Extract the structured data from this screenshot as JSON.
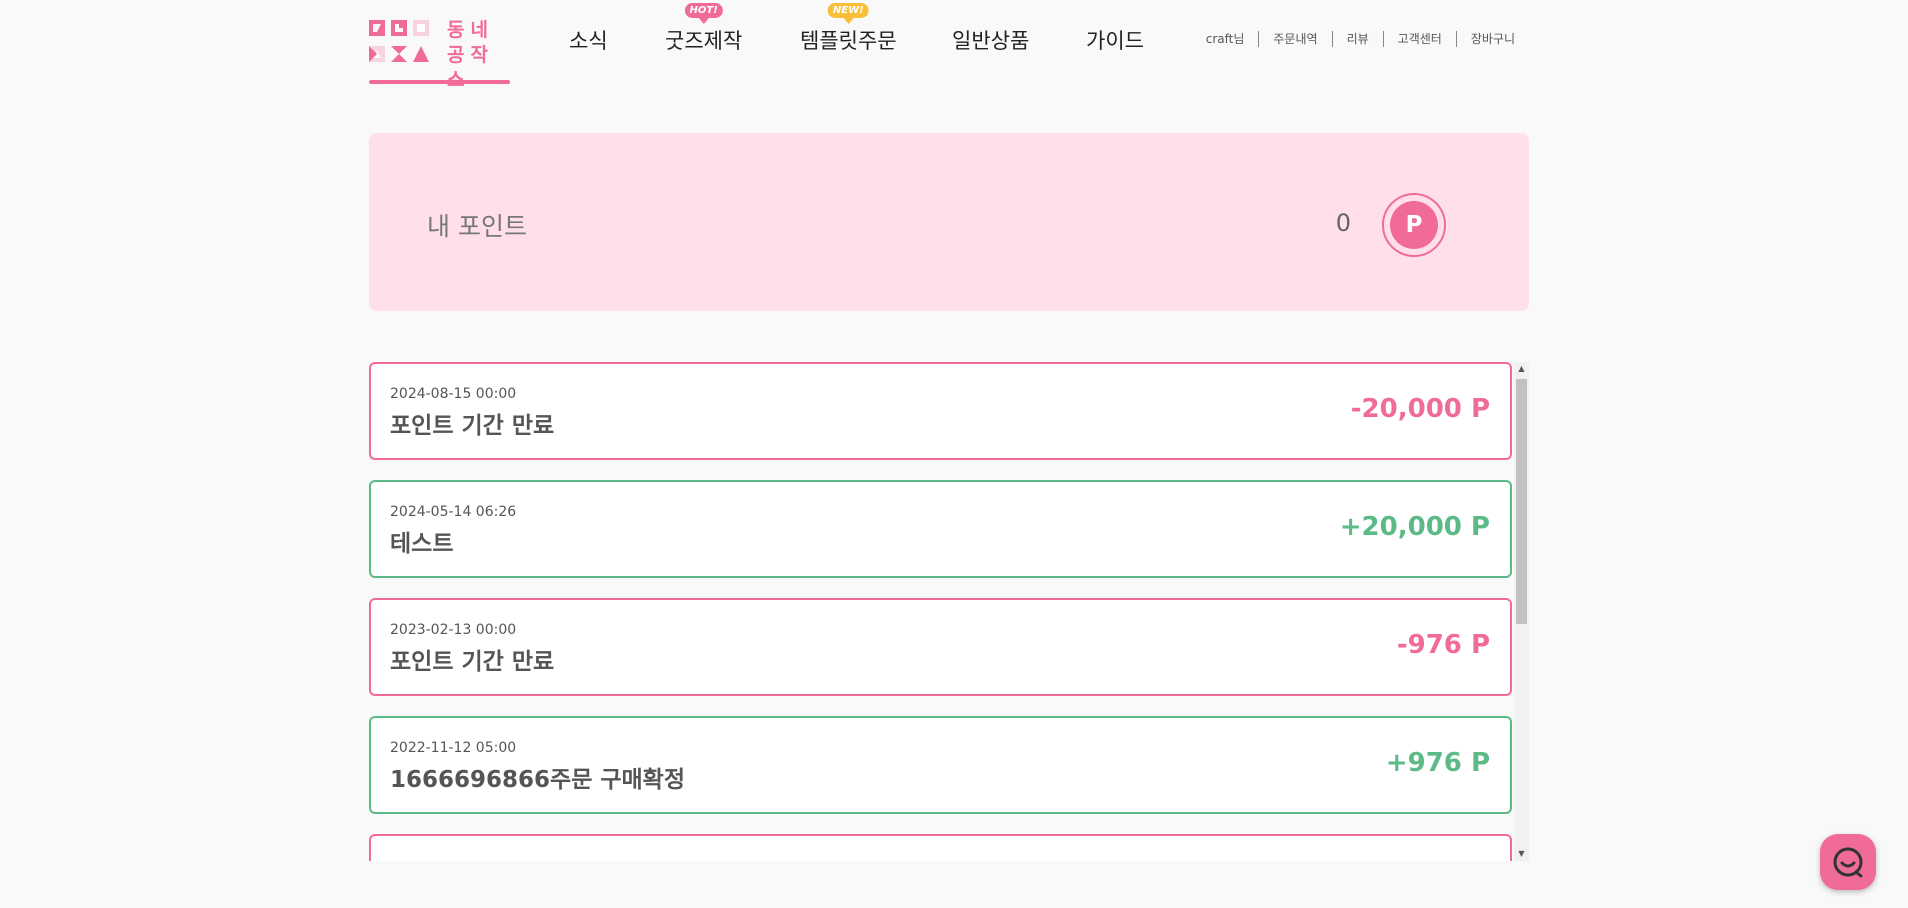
{
  "brand": {
    "line1": "동네",
    "line2": "공작소",
    "accent_color": "#f06b9a"
  },
  "nav": {
    "items": [
      {
        "label": "소식",
        "badge": ""
      },
      {
        "label": "굿즈제작",
        "badge": "HOT!"
      },
      {
        "label": "템플릿주문",
        "badge": "NEW!"
      },
      {
        "label": "일반상품",
        "badge": ""
      },
      {
        "label": "가이드",
        "badge": ""
      }
    ]
  },
  "util": {
    "user": "craft님",
    "orders": "주문내역",
    "review": "리뷰",
    "support": "고객센터",
    "cart": "장바구니"
  },
  "points": {
    "label": "내 포인트",
    "value": "0",
    "coin_letter": "P"
  },
  "history": [
    {
      "date": "2024-08-15 00:00",
      "title": "포인트 기간 만료",
      "amount": "-20,000 P",
      "kind": "minus"
    },
    {
      "date": "2024-05-14 06:26",
      "title": "테스트",
      "amount": "+20,000 P",
      "kind": "plus"
    },
    {
      "date": "2023-02-13 00:00",
      "title": "포인트 기간 만료",
      "amount": "-976 P",
      "kind": "minus"
    },
    {
      "date": "2022-11-12 05:00",
      "title": "1666696866주문 구매확정",
      "amount": "+976 P",
      "kind": "plus"
    },
    {
      "date": "",
      "title": "",
      "amount": "",
      "kind": "minus"
    }
  ],
  "colors": {
    "minus": "#f06b9a",
    "plus": "#5cba86",
    "points_bg": "#ffe0e9"
  }
}
